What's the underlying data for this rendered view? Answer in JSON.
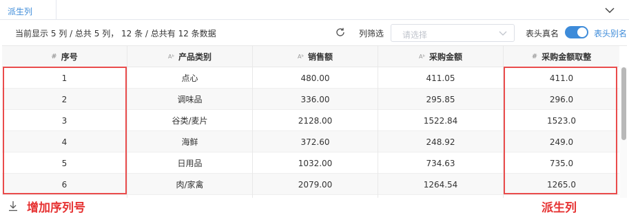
{
  "tab": {
    "label": "派生列"
  },
  "toolbar": {
    "summary": "当前显示 5 列 / 总共 5 列，  12 条 / 总共有 12 条数据",
    "filter_label": "列筛选",
    "select_placeholder": "请选择",
    "realname_label": "表头真名",
    "alias_label": "表头别名",
    "toggle_on": true
  },
  "table": {
    "headers": [
      {
        "label": "序号",
        "type_icon": "#"
      },
      {
        "label": "产品类别",
        "type_icon": "Aᵇ"
      },
      {
        "label": "销售额",
        "type_icon": "Aᵇ"
      },
      {
        "label": "采购金额",
        "type_icon": "Aᵇ"
      },
      {
        "label": "采购金额取整",
        "type_icon": "#"
      }
    ],
    "rows": [
      [
        "1",
        "点心",
        "480.00",
        "411.05",
        "411.0"
      ],
      [
        "2",
        "调味品",
        "336.00",
        "295.85",
        "296.0"
      ],
      [
        "3",
        "谷类/麦片",
        "2128.00",
        "1522.84",
        "1523.0"
      ],
      [
        "4",
        "海鲜",
        "372.60",
        "248.92",
        "249.0"
      ],
      [
        "5",
        "日用品",
        "1032.00",
        "734.63",
        "735.0"
      ],
      [
        "6",
        "肉/家禽",
        "2079.00",
        "1264.54",
        "1265.0"
      ]
    ],
    "alt_row_color": "#f8f8f8"
  },
  "annotations": {
    "left_label": "增加序列号",
    "right_label": "派生列",
    "color": "#e63232"
  },
  "icons": {
    "collapse": "chevron-down-icon",
    "refresh": "refresh-icon",
    "select_arrow": "chevron-down-icon",
    "download": "download-icon"
  },
  "colors": {
    "accent": "#3d8bd9"
  }
}
